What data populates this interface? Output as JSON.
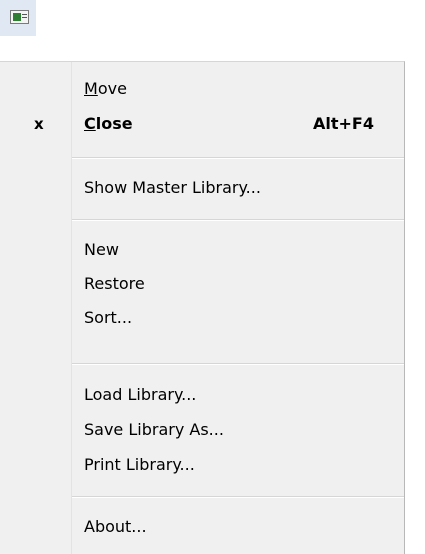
{
  "menu": {
    "move": {
      "label": "Move",
      "mnemonic": "M"
    },
    "close": {
      "label": "Close",
      "mnemonic": "C",
      "check": "x",
      "shortcut": "Alt+F4"
    },
    "show_master_library": {
      "label": "Show Master Library..."
    },
    "new": {
      "label": "New"
    },
    "restore": {
      "label": "Restore"
    },
    "sort": {
      "label": "Sort..."
    },
    "load_library": {
      "label": "Load Library..."
    },
    "save_library_as": {
      "label": "Save Library As..."
    },
    "print_library": {
      "label": "Print Library..."
    },
    "about": {
      "label": "About..."
    }
  },
  "icons": {
    "app": "window-icon"
  }
}
